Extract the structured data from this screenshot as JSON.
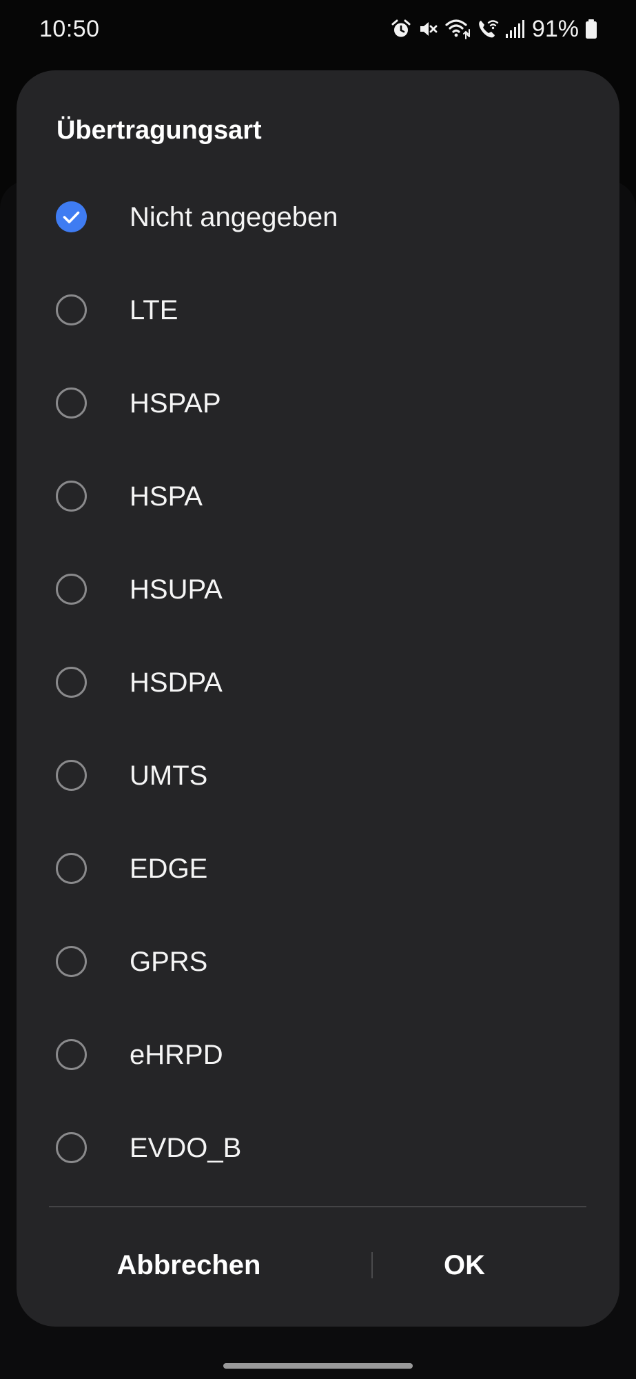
{
  "status_bar": {
    "time": "10:50",
    "battery_percent": "91%",
    "icons": [
      "alarm-icon",
      "mute-icon",
      "wifi-icon",
      "wifi-calling-icon",
      "signal-icon",
      "battery-icon"
    ]
  },
  "dialog": {
    "title": "Übertragungsart",
    "selected_index": 0,
    "options": [
      {
        "label": "Nicht angegeben",
        "checked": true
      },
      {
        "label": "LTE",
        "checked": false
      },
      {
        "label": "HSPAP",
        "checked": false
      },
      {
        "label": "HSPA",
        "checked": false
      },
      {
        "label": "HSUPA",
        "checked": false
      },
      {
        "label": "HSDPA",
        "checked": false
      },
      {
        "label": "UMTS",
        "checked": false
      },
      {
        "label": "EDGE",
        "checked": false
      },
      {
        "label": "GPRS",
        "checked": false
      },
      {
        "label": "eHRPD",
        "checked": false
      },
      {
        "label": "EVDO_B",
        "checked": false
      }
    ],
    "cancel_label": "Abbrechen",
    "ok_label": "OK"
  },
  "colors": {
    "accent": "#3f7cf2",
    "dialog_background": "#252527",
    "screen_background": "#060606"
  }
}
